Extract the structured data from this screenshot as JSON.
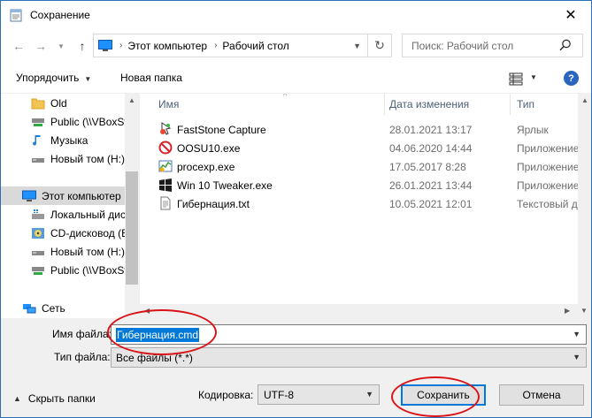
{
  "window": {
    "title": "Сохранение"
  },
  "nav": {
    "address": [
      "Этот компьютер",
      "Рабочий стол"
    ],
    "search_placeholder": "Поиск: Рабочий стол"
  },
  "toolbar": {
    "organize": "Упорядочить",
    "new_folder": "Новая папка"
  },
  "sidebar": {
    "items": [
      {
        "label": "Old",
        "icon": "folder-icon"
      },
      {
        "label": "Public (\\\\VBoxSv",
        "icon": "network-drive-icon"
      },
      {
        "label": "Музыка",
        "icon": "music-icon"
      },
      {
        "label": "Новый том (H:)",
        "icon": "drive-icon"
      },
      {
        "label": "Этот компьютер",
        "icon": "computer-icon"
      },
      {
        "label": "Локальный дис",
        "icon": "windows-drive-icon"
      },
      {
        "label": "CD-дисковод (E",
        "icon": "cd-drive-icon"
      },
      {
        "label": "Новый том (H:)",
        "icon": "drive-icon"
      },
      {
        "label": "Public (\\\\VBoxSv",
        "icon": "network-drive-icon"
      },
      {
        "label": "Сеть",
        "icon": "network-icon"
      }
    ]
  },
  "columns": {
    "name": "Имя",
    "date": "Дата изменения",
    "type": "Тип"
  },
  "files": [
    {
      "name": "FastStone Capture",
      "date": "28.01.2021 13:17",
      "type": "Ярлык",
      "icon": "faststone-shortcut-icon"
    },
    {
      "name": "OOSU10.exe",
      "date": "04.06.2020 14:44",
      "type": "Приложение",
      "icon": "oosu-icon"
    },
    {
      "name": "procexp.exe",
      "date": "17.05.2017 8:28",
      "type": "Приложение",
      "icon": "procexp-icon"
    },
    {
      "name": "Win 10 Tweaker.exe",
      "date": "26.01.2021 13:44",
      "type": "Приложение",
      "icon": "windows-logo-icon"
    },
    {
      "name": "Гибернация.txt",
      "date": "10.05.2021 12:01",
      "type": "Текстовый доку",
      "icon": "text-file-icon"
    }
  ],
  "form": {
    "filename_label": "Имя файла:",
    "filename_value": "Гибернация.cmd",
    "filetype_label": "Тип файла:",
    "filetype_value": "Все файлы (*.*)",
    "encoding_label": "Кодировка:",
    "encoding_value": "UTF-8",
    "hide_folders": "Скрыть папки",
    "save": "Сохранить",
    "cancel": "Отмена"
  },
  "colors": {
    "highlight": "#0078d7",
    "annotation": "#d91419",
    "window_border": "#2b6fb6"
  }
}
